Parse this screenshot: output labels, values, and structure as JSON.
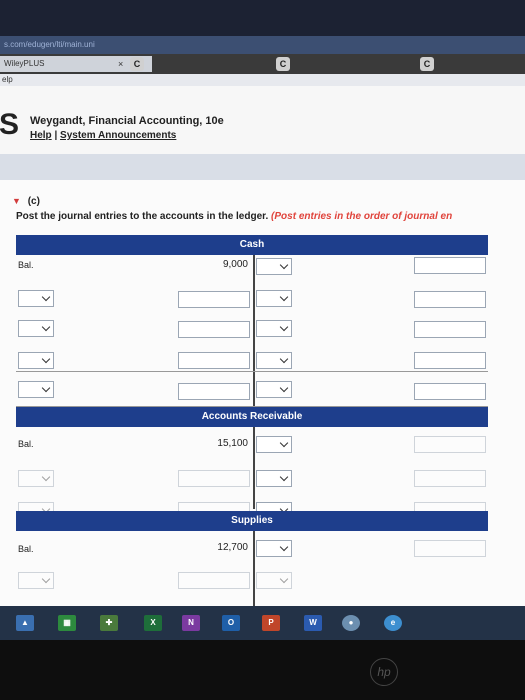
{
  "browser": {
    "address_text": "s.com/edugen/lti/main.uni",
    "tab_title": "WileyPLUS",
    "tab_close": "×",
    "app_button_label": "C",
    "help_fragment": "elp"
  },
  "header": {
    "logo_letter": "S",
    "book_title": "Weygandt, Financial Accounting, 10e",
    "help_link": "Help",
    "separator": "|",
    "announcements_link": "System Announcements"
  },
  "question": {
    "part_label": "(c)",
    "instruction_main": "Post the journal entries to the accounts in the ledger. ",
    "instruction_note": "(Post entries in the order of journal en"
  },
  "ledger": {
    "accounts": [
      {
        "name": "Cash",
        "bal_label": "Bal.",
        "bal_amount": "9,000"
      },
      {
        "name": "Accounts Receivable",
        "bal_label": "Bal.",
        "bal_amount": "15,100"
      },
      {
        "name": "Supplies",
        "bal_label": "Bal.",
        "bal_amount": "12,700"
      }
    ]
  },
  "taskbar": {
    "excel": "X",
    "onenote": "N",
    "outlook": "O",
    "powerpoint": "P",
    "word": "W"
  },
  "device": {
    "brand": "hp"
  }
}
